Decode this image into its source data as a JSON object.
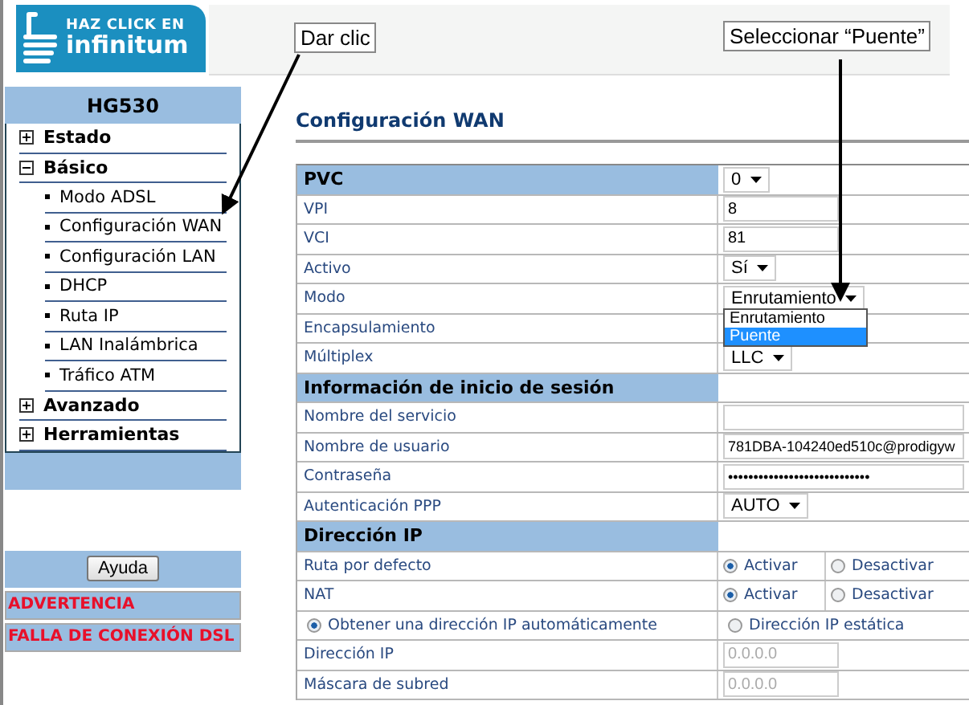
{
  "logo": {
    "line1": "HAZ CLICK EN",
    "line2": "infinitum"
  },
  "callouts": [
    {
      "text": "Dar clic"
    },
    {
      "text": "Seleccionar “Puente”"
    }
  ],
  "sidebar": {
    "title": "HG530",
    "items": [
      {
        "label": "Estado",
        "expanded": false
      },
      {
        "label": "Básico",
        "expanded": true,
        "children": [
          {
            "label": "Modo ADSL"
          },
          {
            "label": "Configuración WAN"
          },
          {
            "label": "Configuración LAN"
          },
          {
            "label": "DHCP"
          },
          {
            "label": "Ruta IP"
          },
          {
            "label": "LAN Inalámbrica"
          },
          {
            "label": "Tráfico ATM"
          }
        ]
      },
      {
        "label": "Avanzado",
        "expanded": false
      },
      {
        "label": "Herramientas",
        "expanded": false
      }
    ],
    "help_button": "Ayuda",
    "warnings": [
      "ADVERTENCIA",
      "FALLA DE CONEXIÓN DSL"
    ]
  },
  "page_title": "Configuración WAN",
  "rows": [
    {
      "kind": "header",
      "label": "PVC",
      "value": "0"
    },
    {
      "kind": "field",
      "label": "VPI",
      "value": "8"
    },
    {
      "kind": "field",
      "label": "VCI",
      "value": "81"
    },
    {
      "kind": "select",
      "label": "Activo",
      "value": "Sí"
    },
    {
      "kind": "select",
      "label": "Modo",
      "value": "Enrutamiento",
      "open": true,
      "options": [
        {
          "label": "Enrutamiento",
          "highlighted": false
        },
        {
          "label": "Puente",
          "highlighted": true
        }
      ]
    },
    {
      "kind": "select",
      "label": "Encapsulamiento"
    },
    {
      "kind": "select",
      "label": "Múltiplex",
      "value": "LLC"
    },
    {
      "kind": "header",
      "label": "Información de inicio de sesión"
    },
    {
      "kind": "wide-field",
      "label": "Nombre del servicio"
    },
    {
      "kind": "wide-field",
      "label": "Nombre de usuario",
      "value": "781DBA-104240ed510c@prodigyw"
    },
    {
      "kind": "wide-field",
      "label": "Contraseña",
      "value": "••••••••••••••••••••••••••••"
    },
    {
      "kind": "select",
      "label": "Autenticación PPP",
      "value": "AUTO"
    },
    {
      "kind": "header",
      "label": "Dirección IP"
    },
    {
      "kind": "radio-pair",
      "label": "Ruta por defecto",
      "options": [
        {
          "label": "Activar",
          "selected": true
        },
        {
          "label": "Desactivar",
          "selected": false
        }
      ]
    },
    {
      "kind": "radio-pair",
      "label": "NAT",
      "options": [
        {
          "label": "Activar",
          "selected": true
        },
        {
          "label": "Desactivar",
          "selected": false
        }
      ]
    },
    {
      "kind": "radio-split",
      "options": [
        {
          "label": "Obtener una dirección IP automáticamente",
          "selected": true
        },
        {
          "label": "Dirección IP estática",
          "selected": false
        }
      ]
    },
    {
      "kind": "field",
      "label": "Dirección IP",
      "placeholder": "0.0.0.0"
    },
    {
      "kind": "field",
      "label": "Máscara de subred",
      "placeholder": "0.0.0.0"
    }
  ]
}
